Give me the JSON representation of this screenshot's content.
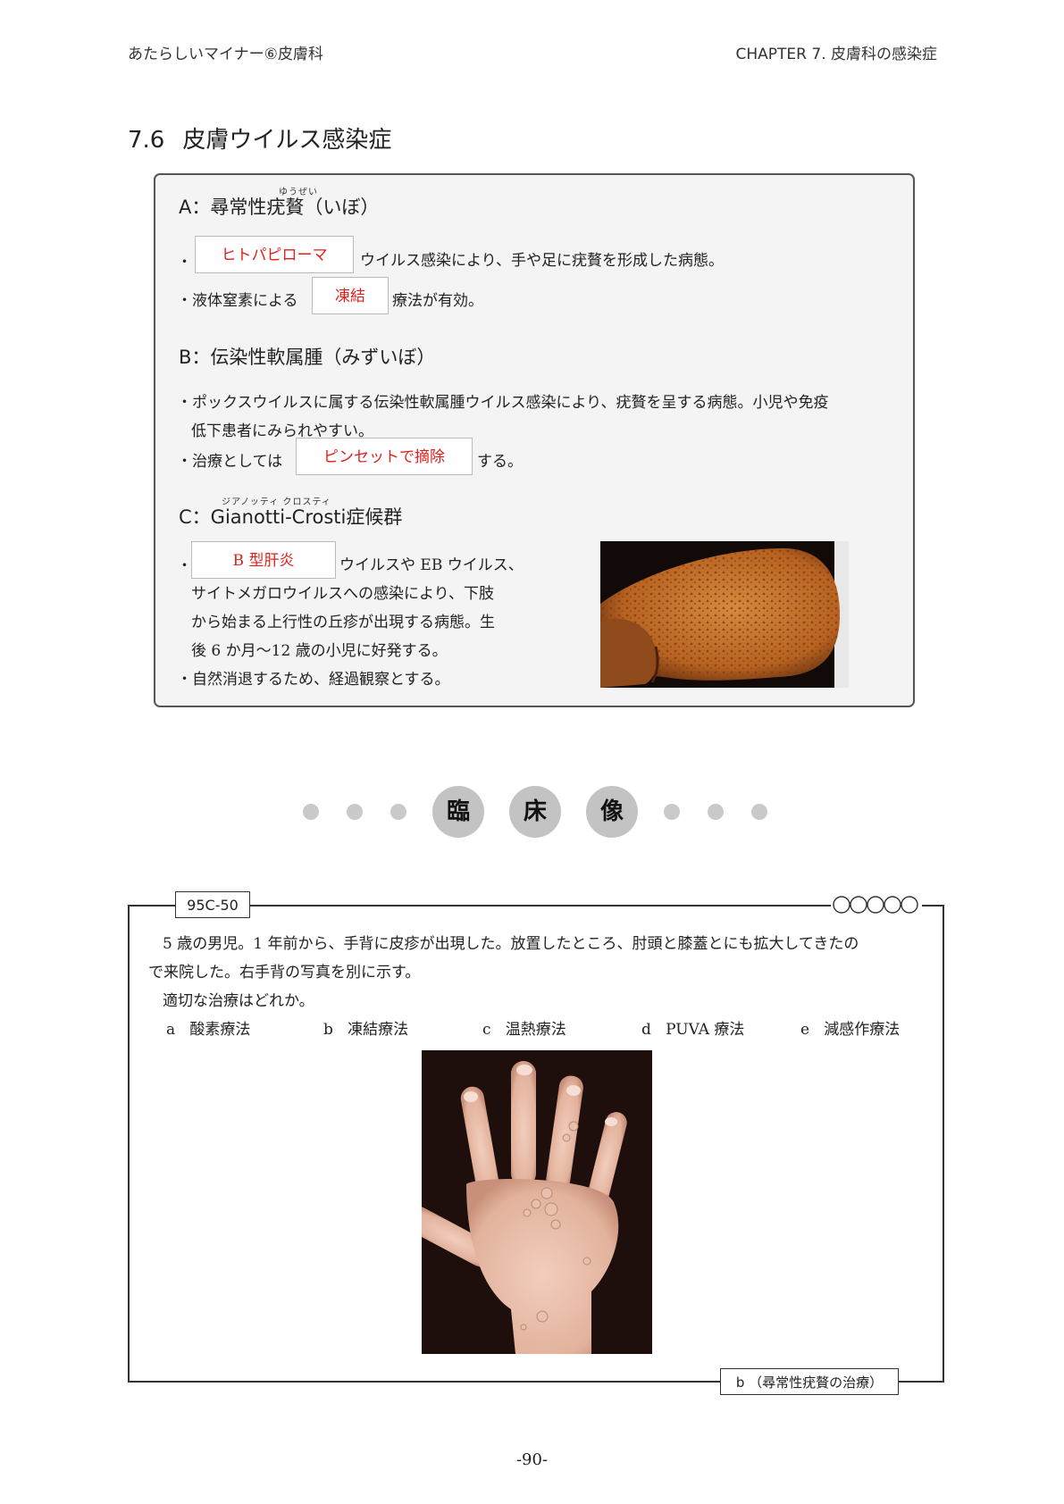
{
  "header": {
    "left": "あたらしいマイナー⑥皮膚科",
    "right": "CHAPTER  7.  皮膚科の感染症"
  },
  "section": {
    "number": "7.6",
    "title": "皮膚ウイルス感染症"
  },
  "card": {
    "a": {
      "heading_prefix": "A：尋常性",
      "heading_term": "疣贅",
      "heading_suffix": "（いぼ）",
      "ruby": "ゆうぜい",
      "bullet1_blank": "ヒトパピローマ",
      "bullet1_text": "ウイルス感染により、手や足に疣贅を形成した病態。",
      "bullet2_pre": "・液体窒素による",
      "bullet2_blank": "凍結",
      "bullet2_post": "療法が有効。"
    },
    "b": {
      "heading": "B：伝染性軟属腫（みずいぼ）",
      "bullet1_line1": "・ポックスウイルスに属する伝染性軟属腫ウイルス感染により、疣贅を呈する病態。小児や免疫",
      "bullet1_line2": "低下患者にみられやすい。",
      "bullet2_pre": "・治療としては",
      "bullet2_blank": "ピンセットで摘除",
      "bullet2_post": "する。"
    },
    "c": {
      "ruby": "ジアノッティ  クロスティ",
      "heading_prefix": "C：",
      "heading_name": "Gianotti-Crosti",
      "heading_suffix": "症候群",
      "bullet1_blank": "B 型肝炎",
      "bullet1_line1": "ウイルスや EB ウイルス、",
      "bullet1_line2": "サイトメガロウイルスへの感染により、下肢",
      "bullet1_line3": "から始まる上行性の丘疹が出現する病態。生",
      "bullet1_line4": "後 6 か月〜12 歳の小児に好発する。",
      "bullet2": "・自然消退するため、経過観察とする。"
    }
  },
  "divider": {
    "chars": [
      "臨",
      "床",
      "像"
    ]
  },
  "question": {
    "id": "95C-50",
    "line1": "5 歳の男児。1 年前から、手背に皮疹が出現した。放置したところ、肘頭と膝蓋とにも拡大してきたの",
    "line2": "で来院した。右手背の写真を別に示す。",
    "line3": "適切な治療はどれか。",
    "options": [
      {
        "letter": "a",
        "text": "酸素療法"
      },
      {
        "letter": "b",
        "text": "凍結療法"
      },
      {
        "letter": "c",
        "text": "温熱療法"
      },
      {
        "letter": "d",
        "text": "PUVA 療法"
      },
      {
        "letter": "e",
        "text": "減感作療法"
      }
    ],
    "answer": "b （尋常性疣贅の治療）"
  },
  "page_number": "-90-"
}
